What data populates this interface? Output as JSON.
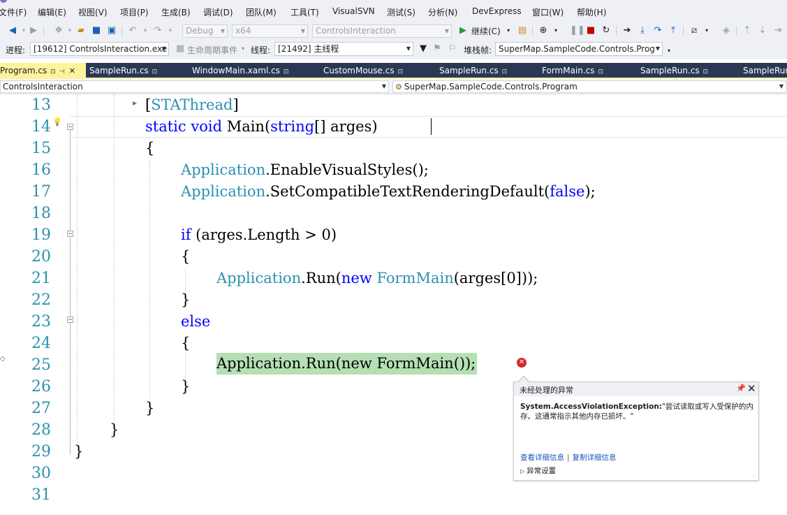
{
  "menu": [
    "文件(F)",
    "编辑(E)",
    "视图(V)",
    "项目(P)",
    "生成(B)",
    "调试(D)",
    "团队(M)",
    "工具(T)",
    "VisualSVN",
    "测试(S)",
    "分析(N)",
    "DevExpress",
    "窗口(W)",
    "帮助(H)"
  ],
  "toolbar": {
    "config": "Debug",
    "platform": "x64",
    "startup_project": "ControlsInteraction",
    "continue_label": "继续(C)"
  },
  "debug_location": {
    "process_label": "进程:",
    "process_value": "[19612] ControlsInteraction.exe",
    "lifecycle_label": "生命周期事件",
    "thread_label": "线程:",
    "thread_value": "[21492] 主线程",
    "stackframe_label": "堆栈帧:",
    "stackframe_value": "SuperMap.SampleCode.Controls.Prog"
  },
  "tabs": [
    {
      "label": "Program.cs"
    },
    {
      "label": "SampleRun.cs"
    },
    {
      "label": "WindowMain.xaml.cs"
    },
    {
      "label": "CustomMouse.cs"
    },
    {
      "label": "SampleRun.cs"
    },
    {
      "label": "FormMain.cs"
    },
    {
      "label": "SampleRun.cs"
    },
    {
      "label": "SampleRun"
    }
  ],
  "nav": {
    "project": "ControlsInteraction",
    "member": "SuperMap.SampleCode.Controls.Program"
  },
  "editor": {
    "line_numbers": [
      "13",
      "14",
      "15",
      "16",
      "17",
      "18",
      "19",
      "20",
      "21",
      "22",
      "23",
      "24",
      "25",
      "26",
      "27",
      "28",
      "29",
      "30",
      "31"
    ],
    "lines": {
      "l13": {
        "p1": "[",
        "p2": "STAThread",
        "p3": "]"
      },
      "l14": {
        "k1": "static",
        "k2": "void",
        "t1": " Main(",
        "k3": "string",
        "t2": "[] arges)"
      },
      "l15": {
        "t": "{"
      },
      "l16": {
        "ty": "Application",
        "t": ".EnableVisualStyles();"
      },
      "l17": {
        "ty": "Application",
        "t1": ".SetCompatibleTextRenderingDefault(",
        "k": "false",
        "t2": ");"
      },
      "l19": {
        "k": "if",
        "t": " (arges.Length > 0)"
      },
      "l20": {
        "t": "{"
      },
      "l21": {
        "ty": "Application",
        "t1": ".Run(",
        "k": "new",
        "t2": " ",
        "ty2": "FormMain",
        "t3": "(arges[0]));"
      },
      "l22": {
        "t": "}"
      },
      "l23": {
        "k": "else"
      },
      "l24": {
        "t": "{"
      },
      "l25": {
        "t": "Application.Run(new FormMain());"
      },
      "l26": {
        "t": "}"
      },
      "l27": {
        "t": "}"
      },
      "l28": {
        "t": "}"
      },
      "l29": {
        "t": "}"
      }
    }
  },
  "exception": {
    "title": "未经处理的异常",
    "type": "System.AccessViolationException:",
    "message": "\"尝试读取或写入受保护的内存。这通常指示其他内存已损坏。\"",
    "link_details": "查看详细信息",
    "link_copy": "复制详细信息",
    "settings": "异常设置"
  },
  "colors": {
    "menu_bg": "#eef0f6",
    "tab_strip": "#293955",
    "active_tab": "#fff29d",
    "line_number": "#2b91af",
    "keyword": "#0000ff",
    "type": "#2b91af",
    "current_statement": "#b4e0b4",
    "error": "#d22b2b"
  }
}
